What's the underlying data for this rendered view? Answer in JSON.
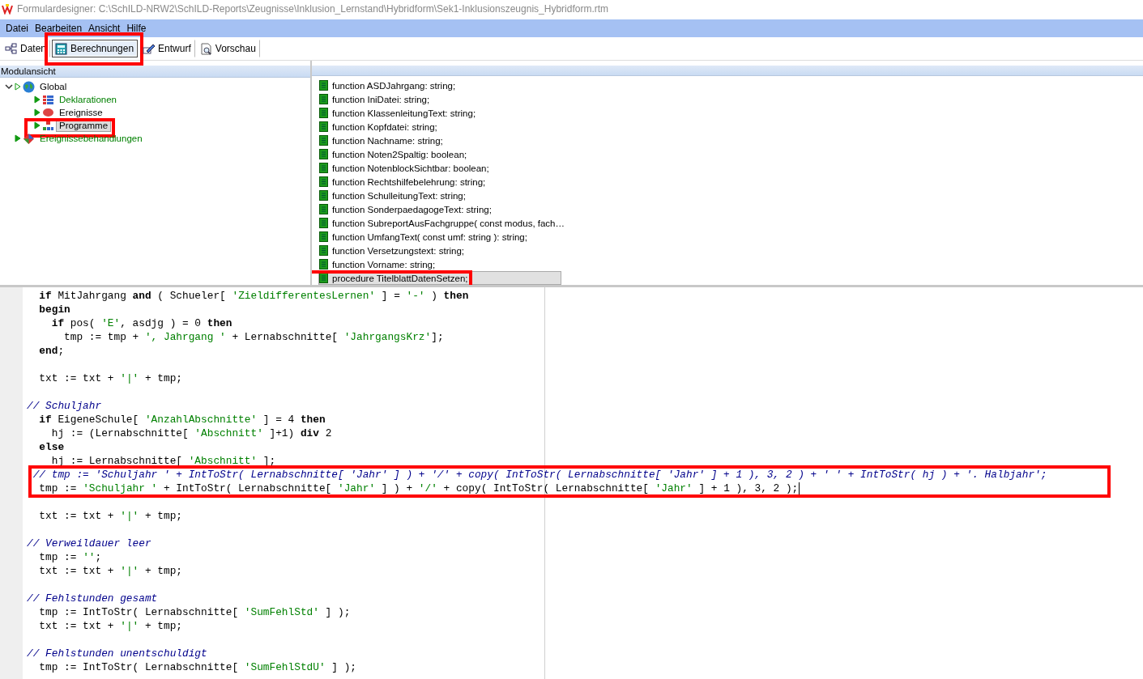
{
  "window": {
    "title": "Formulardesigner: C:\\SchILD-NRW2\\SchILD-Reports\\Zeugnisse\\Inklusion_Lernstand\\Hybridform\\Sek1-Inklusionszeugnis_Hybridform.rtm"
  },
  "menu": [
    "Datei",
    "Bearbeiten",
    "Ansicht",
    "Hilfe"
  ],
  "tabs": [
    {
      "label": "Daten",
      "kind": "data",
      "selected": false
    },
    {
      "label": "Berechnungen",
      "kind": "calc",
      "selected": true,
      "highlighted": true
    },
    {
      "label": "Entwurf",
      "kind": "design",
      "selected": false
    },
    {
      "label": "Vorschau",
      "kind": "preview",
      "selected": false
    }
  ],
  "module_view": {
    "title": "Modulansicht",
    "tree": [
      {
        "label": "Global",
        "kind": "global",
        "color": "#000000",
        "expanded": true,
        "selected": false,
        "children": [
          {
            "label": "Deklarationen",
            "kind": "declarations",
            "color": "#008000",
            "selected": false
          },
          {
            "label": "Ereignisse",
            "kind": "events",
            "color": "#000000",
            "selected": false
          },
          {
            "label": "Programme",
            "kind": "programs",
            "color": "#000000",
            "selected": true,
            "highlighted": true
          }
        ]
      },
      {
        "label": "Ereignissebehandlungen",
        "kind": "handlers",
        "color": "#008000",
        "selected": false
      }
    ]
  },
  "routines": [
    {
      "label": "function ASDJahrgang: string;",
      "selected": false
    },
    {
      "label": "function IniDatei: string;",
      "selected": false
    },
    {
      "label": "function KlassenleitungText: string;",
      "selected": false
    },
    {
      "label": "function Kopfdatei: string;",
      "selected": false
    },
    {
      "label": "function Nachname: string;",
      "selected": false
    },
    {
      "label": "function Noten2Spaltig: boolean;",
      "selected": false
    },
    {
      "label": "function NotenblockSichtbar: boolean;",
      "selected": false
    },
    {
      "label": "function Rechtshilfebelehrung: string;",
      "selected": false
    },
    {
      "label": "function SchulleitungText: string;",
      "selected": false
    },
    {
      "label": "function SonderpaedagogeText: string;",
      "selected": false
    },
    {
      "label": "function SubreportAusFachgruppe( const modus, fach…",
      "selected": false
    },
    {
      "label": "function UmfangText( const umf: string ): string;",
      "selected": false
    },
    {
      "label": "function Versetzungstext: string;",
      "selected": false
    },
    {
      "label": "function Vorname: string;",
      "selected": false
    },
    {
      "label": "procedure TitelblattDatenSetzen;",
      "selected": true,
      "highlighted": true
    }
  ],
  "code": {
    "lines": [
      {
        "kind": "code",
        "parts": [
          {
            "kind": "keyword",
            "t": "  if"
          },
          {
            "kind": "plain",
            "t": " MitJahrgang "
          },
          {
            "kind": "keyword",
            "t": "and"
          },
          {
            "kind": "plain",
            "t": " ( Schueler[ "
          },
          {
            "kind": "string",
            "t": "'ZieldifferentesLernen'"
          },
          {
            "kind": "plain",
            "t": " ] = "
          },
          {
            "kind": "string",
            "t": "'-'"
          },
          {
            "kind": "plain",
            "t": " ) "
          },
          {
            "kind": "keyword",
            "t": "then"
          }
        ]
      },
      {
        "kind": "code",
        "parts": [
          {
            "kind": "keyword",
            "t": "  begin"
          }
        ]
      },
      {
        "kind": "code",
        "parts": [
          {
            "kind": "keyword",
            "t": "    if"
          },
          {
            "kind": "plain",
            "t": " pos( "
          },
          {
            "kind": "string",
            "t": "'E'"
          },
          {
            "kind": "plain",
            "t": ", asdjg ) = 0 "
          },
          {
            "kind": "keyword",
            "t": "then"
          }
        ]
      },
      {
        "kind": "code",
        "parts": [
          {
            "kind": "plain",
            "t": "      tmp := tmp + "
          },
          {
            "kind": "string",
            "t": "', Jahrgang '"
          },
          {
            "kind": "plain",
            "t": " + Lernabschnitte[ "
          },
          {
            "kind": "string",
            "t": "'JahrgangsKrz'"
          },
          {
            "kind": "plain",
            "t": "];"
          }
        ]
      },
      {
        "kind": "code",
        "parts": [
          {
            "kind": "keyword",
            "t": "  end"
          },
          {
            "kind": "plain",
            "t": ";"
          }
        ]
      },
      {
        "kind": "blank"
      },
      {
        "kind": "code",
        "parts": [
          {
            "kind": "plain",
            "t": "  txt := txt + "
          },
          {
            "kind": "string",
            "t": "'|'"
          },
          {
            "kind": "plain",
            "t": " + tmp;"
          }
        ]
      },
      {
        "kind": "blank"
      },
      {
        "kind": "code",
        "parts": [
          {
            "kind": "comment",
            "t": "// Schuljahr"
          }
        ]
      },
      {
        "kind": "code",
        "parts": [
          {
            "kind": "keyword",
            "t": "  if"
          },
          {
            "kind": "plain",
            "t": " EigeneSchule[ "
          },
          {
            "kind": "string",
            "t": "'AnzahlAbschnitte'"
          },
          {
            "kind": "plain",
            "t": " ] = 4 "
          },
          {
            "kind": "keyword",
            "t": "then"
          }
        ]
      },
      {
        "kind": "code",
        "parts": [
          {
            "kind": "plain",
            "t": "    hj := (Lernabschnitte[ "
          },
          {
            "kind": "string",
            "t": "'Abschnitt'"
          },
          {
            "kind": "plain",
            "t": " ]+1) "
          },
          {
            "kind": "keyword",
            "t": "div"
          },
          {
            "kind": "plain",
            "t": " 2"
          }
        ]
      },
      {
        "kind": "code",
        "parts": [
          {
            "kind": "keyword",
            "t": "  else"
          }
        ]
      },
      {
        "kind": "code",
        "parts": [
          {
            "kind": "plain",
            "t": "    hj := Lernabschnitte[ "
          },
          {
            "kind": "string",
            "t": "'Abschnitt'"
          },
          {
            "kind": "plain",
            "t": " ];"
          }
        ]
      },
      {
        "kind": "code",
        "highlighted": true,
        "parts": [
          {
            "kind": "comment",
            "t": " // tmp := 'Schuljahr ' + IntToStr( Lernabschnitte[ 'Jahr' ] ) + '/' + copy( IntToStr( Lernabschnitte[ 'Jahr' ] + 1 ), 3, 2 ) + ' ' + IntToStr( hj ) + '. Halbjahr';"
          }
        ]
      },
      {
        "kind": "code",
        "highlighted": true,
        "caret": true,
        "parts": [
          {
            "kind": "plain",
            "t": "  tmp := "
          },
          {
            "kind": "string",
            "t": "'Schuljahr '"
          },
          {
            "kind": "plain",
            "t": " + IntToStr( Lernabschnitte[ "
          },
          {
            "kind": "string",
            "t": "'Jahr'"
          },
          {
            "kind": "plain",
            "t": " ] ) + "
          },
          {
            "kind": "string",
            "t": "'/'"
          },
          {
            "kind": "plain",
            "t": " + copy( IntToStr( Lernabschnitte[ "
          },
          {
            "kind": "string",
            "t": "'Jahr'"
          },
          {
            "kind": "plain",
            "t": " ] + 1 ), 3, 2 );"
          }
        ]
      },
      {
        "kind": "blank"
      },
      {
        "kind": "code",
        "parts": [
          {
            "kind": "plain",
            "t": "  txt := txt + "
          },
          {
            "kind": "string",
            "t": "'|'"
          },
          {
            "kind": "plain",
            "t": " + tmp;"
          }
        ]
      },
      {
        "kind": "blank"
      },
      {
        "kind": "code",
        "parts": [
          {
            "kind": "comment",
            "t": "// Verweildauer leer"
          }
        ]
      },
      {
        "kind": "code",
        "parts": [
          {
            "kind": "plain",
            "t": "  tmp := "
          },
          {
            "kind": "string",
            "t": "''"
          },
          {
            "kind": "plain",
            "t": ";"
          }
        ]
      },
      {
        "kind": "code",
        "parts": [
          {
            "kind": "plain",
            "t": "  txt := txt + "
          },
          {
            "kind": "string",
            "t": "'|'"
          },
          {
            "kind": "plain",
            "t": " + tmp;"
          }
        ]
      },
      {
        "kind": "blank"
      },
      {
        "kind": "code",
        "parts": [
          {
            "kind": "comment",
            "t": "// Fehlstunden gesamt"
          }
        ]
      },
      {
        "kind": "code",
        "parts": [
          {
            "kind": "plain",
            "t": "  tmp := IntToStr( Lernabschnitte[ "
          },
          {
            "kind": "string",
            "t": "'SumFehlStd'"
          },
          {
            "kind": "plain",
            "t": " ] );"
          }
        ]
      },
      {
        "kind": "code",
        "parts": [
          {
            "kind": "plain",
            "t": "  txt := txt + "
          },
          {
            "kind": "string",
            "t": "'|'"
          },
          {
            "kind": "plain",
            "t": " + tmp;"
          }
        ]
      },
      {
        "kind": "blank"
      },
      {
        "kind": "code",
        "parts": [
          {
            "kind": "comment",
            "t": "// Fehlstunden unentschuldigt"
          }
        ]
      },
      {
        "kind": "code",
        "parts": [
          {
            "kind": "plain",
            "t": "  tmp := IntToStr( Lernabschnitte[ "
          },
          {
            "kind": "string",
            "t": "'SumFehlStdU'"
          },
          {
            "kind": "plain",
            "t": " ] );"
          }
        ]
      }
    ]
  }
}
